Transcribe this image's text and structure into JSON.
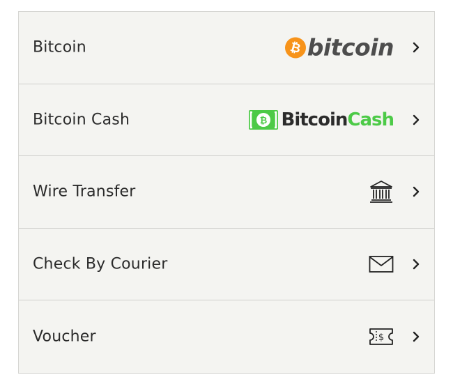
{
  "payment_methods": [
    {
      "label": "Bitcoin",
      "logo_text": "bitcoin",
      "logo_symbol": "₿",
      "icon": "bitcoin-logo"
    },
    {
      "label": "Bitcoin Cash",
      "logo_text_1": "Bitcoin",
      "logo_text_2": "Cash",
      "icon": "bitcoin-cash-logo"
    },
    {
      "label": "Wire Transfer",
      "icon": "bank-icon"
    },
    {
      "label": "Check By Courier",
      "icon": "envelope-icon"
    },
    {
      "label": "Voucher",
      "icon": "voucher-icon"
    }
  ],
  "colors": {
    "bitcoin_orange": "#f7931a",
    "bitcoin_cash_green": "#4cca47",
    "row_background": "#f4f4f1",
    "text": "#2b2b2b"
  }
}
